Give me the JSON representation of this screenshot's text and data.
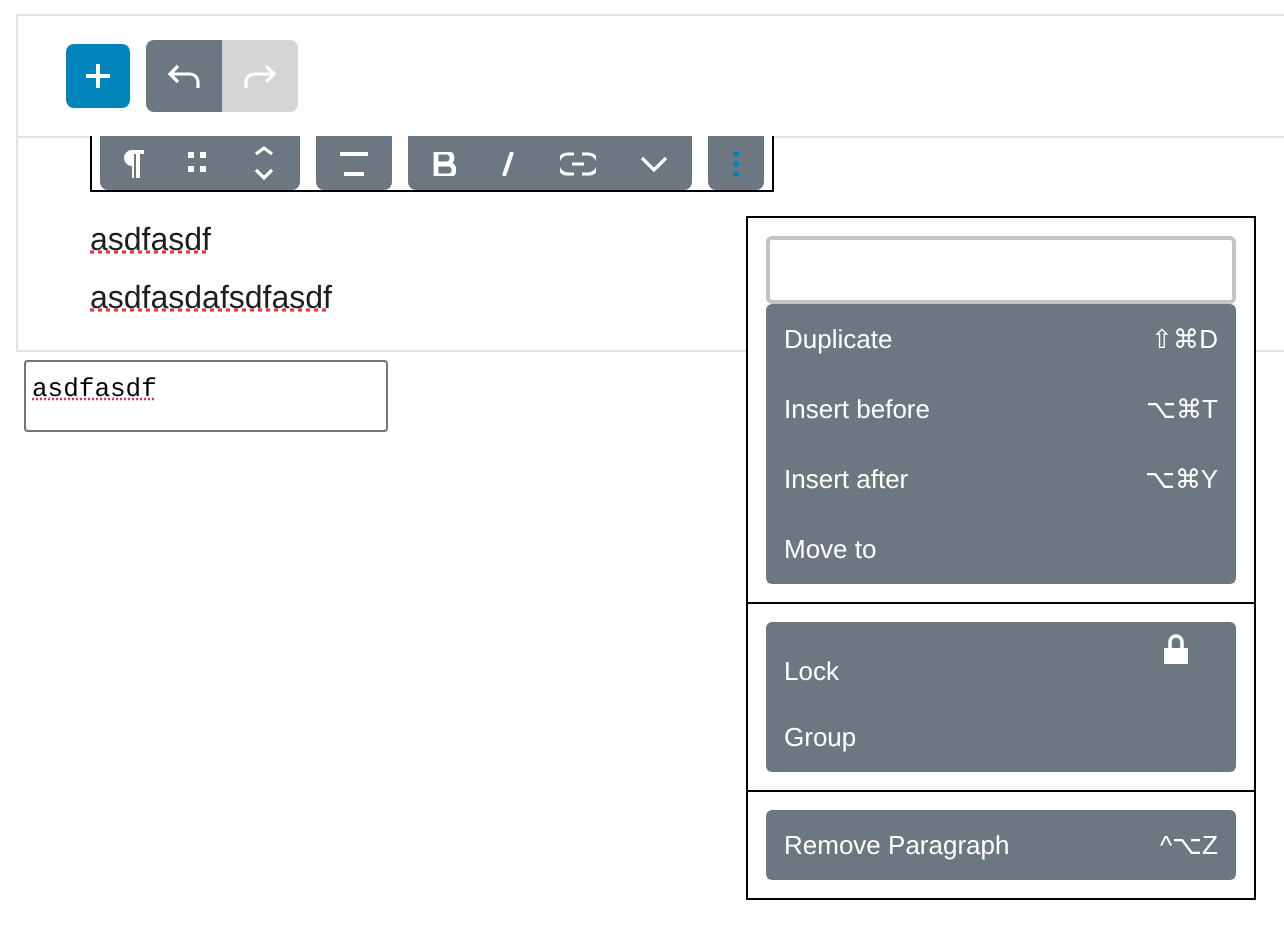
{
  "header": {
    "buttons": [
      {
        "kind": "add",
        "disabled": false
      },
      {
        "kind": "undo",
        "disabled": false
      },
      {
        "kind": "redo",
        "disabled": true
      }
    ]
  },
  "toolbar": {
    "groups": [
      {
        "tools": [
          {
            "kind": "paragraph"
          },
          {
            "kind": "drag"
          },
          {
            "kind": "mover"
          }
        ]
      },
      {
        "tools": [
          {
            "kind": "align"
          }
        ]
      },
      {
        "tools": [
          {
            "kind": "bold"
          },
          {
            "kind": "italic"
          },
          {
            "kind": "link"
          },
          {
            "kind": "more"
          }
        ]
      },
      {
        "tools": [
          {
            "kind": "options"
          }
        ]
      }
    ]
  },
  "paragraphs": [
    "asdfasdf",
    "asdfasdafsdfasdf"
  ],
  "textarea": {
    "value": "asdfasdf"
  },
  "menu": {
    "sections": [
      {
        "items": [
          {
            "kind": "plain",
            "label": "Duplicate",
            "shortcut": "⇧⌘D"
          },
          {
            "kind": "plain",
            "label": "Insert before",
            "shortcut": "⌥⌘T"
          },
          {
            "kind": "plain",
            "label": "Insert after",
            "shortcut": "⌥⌘Y"
          },
          {
            "kind": "plain",
            "label": "Move to"
          }
        ]
      },
      {
        "items": [
          {
            "kind": "lock",
            "label": "Lock"
          },
          {
            "kind": "plain",
            "label": "Group"
          }
        ]
      },
      {
        "items": [
          {
            "kind": "plain",
            "label": "Remove Paragraph",
            "shortcut": "^⌥Z"
          }
        ]
      }
    ]
  }
}
